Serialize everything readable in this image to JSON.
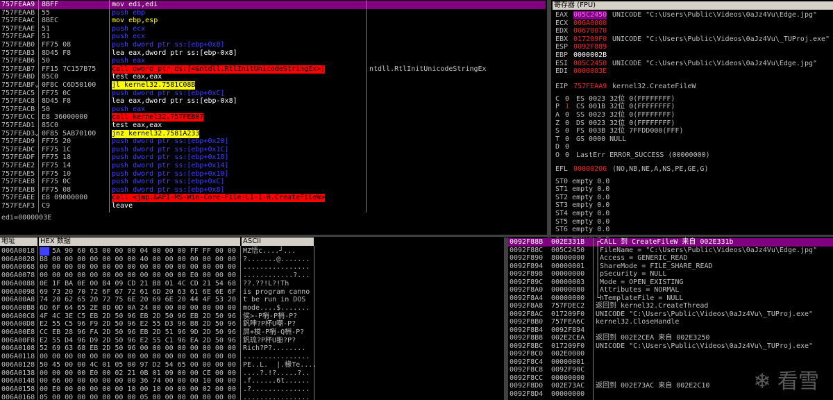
{
  "disasm": {
    "rows": [
      {
        "addr": "757FEAA9",
        "mark": "",
        "bytes": "8BFF",
        "instr": "mov edi,edi",
        "type": "mov",
        "comment": ""
      },
      {
        "addr": "757FEAAB",
        "mark": "",
        "bytes": "55",
        "instr": "push ebp",
        "type": "push",
        "comment": ""
      },
      {
        "addr": "757FEAAC",
        "mark": "",
        "bytes": "8BEC",
        "instr": "mov ebp,esp",
        "type": "mov",
        "comment": ""
      },
      {
        "addr": "757FEAAE",
        "mark": "",
        "bytes": "51",
        "instr": "push ecx",
        "type": "push",
        "comment": ""
      },
      {
        "addr": "757FEAAF",
        "mark": "",
        "bytes": "51",
        "instr": "push ecx",
        "type": "push",
        "comment": ""
      },
      {
        "addr": "757FEAB0",
        "mark": "",
        "bytes": "FF75 08",
        "instr": "push dword ptr ss:[ebp+0x8]",
        "type": "push",
        "comment": ""
      },
      {
        "addr": "757FEAB3",
        "mark": "",
        "bytes": "8D45 F8",
        "instr": "lea eax,dword ptr ss:[ebp-0x8]",
        "type": "lea",
        "comment": ""
      },
      {
        "addr": "757FEAB6",
        "mark": "",
        "bytes": "50",
        "instr": "push eax",
        "type": "push",
        "comment": ""
      },
      {
        "addr": "757FEAB7",
        "mark": "",
        "bytes": "FF15 7C157B75",
        "instr": "call dword ptr ds:[<&ntdll.RtlInitUnicodeStringEx>]",
        "type": "call",
        "comment": "ntdll.RtlInitUnicodeStringEx"
      },
      {
        "addr": "757FEABD",
        "mark": "",
        "bytes": "85C0",
        "instr": "test eax,eax",
        "type": "cmd",
        "comment": ""
      },
      {
        "addr": "757FEABF",
        "mark": "⌄",
        "bytes": "0F8C C6D50100",
        "instr": "jl kernel32.7581C08B",
        "type": "jmp",
        "comment": ""
      },
      {
        "addr": "757FEAC5",
        "mark": "",
        "bytes": "FF75 0C",
        "instr": "push dword ptr ss:[ebp+0xC]",
        "type": "push",
        "comment": ""
      },
      {
        "addr": "757FEAC8",
        "mark": "",
        "bytes": "8D45 F8",
        "instr": "lea eax,dword ptr ss:[ebp-0x8]",
        "type": "lea",
        "comment": ""
      },
      {
        "addr": "757FEACB",
        "mark": "",
        "bytes": "50",
        "instr": "push eax",
        "type": "push",
        "comment": ""
      },
      {
        "addr": "757FEACC",
        "mark": "",
        "bytes": "E8 36000000",
        "instr": "call kernel32.757FEB07",
        "type": "call",
        "comment": ""
      },
      {
        "addr": "757FEAD1",
        "mark": "",
        "bytes": "85C0",
        "instr": "test eax,eax",
        "type": "cmd",
        "comment": ""
      },
      {
        "addr": "757FEAD3",
        "mark": "⌄",
        "bytes": "0F85 5AB70100",
        "instr": "jnz kernel32.7581A233",
        "type": "jmp",
        "comment": ""
      },
      {
        "addr": "757FEAD9",
        "mark": "",
        "bytes": "FF75 20",
        "instr": "push dword ptr ss:[ebp+0x20]",
        "type": "push",
        "comment": ""
      },
      {
        "addr": "757FEADC",
        "mark": "",
        "bytes": "FF75 1C",
        "instr": "push dword ptr ss:[ebp+0x1C]",
        "type": "push",
        "comment": ""
      },
      {
        "addr": "757FEADF",
        "mark": "",
        "bytes": "FF75 18",
        "instr": "push dword ptr ss:[ebp+0x18]",
        "type": "push",
        "comment": ""
      },
      {
        "addr": "757FEAE2",
        "mark": "",
        "bytes": "FF75 14",
        "instr": "push dword ptr ss:[ebp+0x14]",
        "type": "push",
        "comment": ""
      },
      {
        "addr": "757FEAE5",
        "mark": "",
        "bytes": "FF75 10",
        "instr": "push dword ptr ss:[ebp+0x10]",
        "type": "push",
        "comment": ""
      },
      {
        "addr": "757FEAE8",
        "mark": "",
        "bytes": "FF75 0C",
        "instr": "push dword ptr ss:[ebp+0xC]",
        "type": "push",
        "comment": ""
      },
      {
        "addr": "757FEAEB",
        "mark": "",
        "bytes": "FF75 08",
        "instr": "push dword ptr ss:[ebp+0x8]",
        "type": "push",
        "comment": ""
      },
      {
        "addr": "757FEAEE",
        "mark": "",
        "bytes": "E8 09000000",
        "instr": "call <jmp.&API-MS-Win-Core-File-L1-1-0.CreateFileW>",
        "type": "call",
        "comment": ""
      },
      {
        "addr": "757FEAF3",
        "mark": "",
        "bytes": "C9",
        "instr": "leave",
        "type": "leave",
        "comment": ""
      }
    ]
  },
  "info_line": "edi=0000003E",
  "registers": {
    "title": "寄存器 (FPU)",
    "gp": [
      {
        "name": "EAX",
        "value": "005C2450",
        "hl": true,
        "note": "UNICODE \"C:\\Users\\Public\\Videos\\0aJz4Vu\\Edge.jpg\""
      },
      {
        "name": "ECX",
        "value": "006A0000",
        "hl": false,
        "note": ""
      },
      {
        "name": "EDX",
        "value": "00670070",
        "hl": false,
        "note": ""
      },
      {
        "name": "EBX",
        "value": "017209F0",
        "hl": false,
        "note": "UNICODE \"C:\\Users\\Public\\Videos\\0aJz4Vu\\_TUProj.exe\""
      },
      {
        "name": "ESP",
        "value": "0092F889",
        "hl": false,
        "note": ""
      },
      {
        "name": "EBP",
        "value": "0000002B",
        "hl": false,
        "white": true,
        "note": ""
      },
      {
        "name": "ESI",
        "value": "005C2450",
        "hl": false,
        "note": "UNICODE \"C:\\Users\\Public\\Videos\\0aJz4Vu\\Edge.jpg\""
      },
      {
        "name": "EDI",
        "value": "0000003E",
        "hl": false,
        "note": ""
      }
    ],
    "eip": {
      "name": "EIP",
      "value": "757FEAA9",
      "note": "kernel32.CreateFileW"
    },
    "flags": [
      {
        "f": "C",
        "v": "0",
        "seg": "ES 0023 32位 0(FFFFFFFF)"
      },
      {
        "f": "P",
        "v": "1",
        "seg": "CS 001B 32位 0(FFFFFFFF)"
      },
      {
        "f": "A",
        "v": "0",
        "seg": "SS 0023 32位 0(FFFFFFFF)"
      },
      {
        "f": "Z",
        "v": "0",
        "seg": "DS 0023 32位 0(FFFFFFFF)"
      },
      {
        "f": "S",
        "v": "0",
        "seg": "FS 003B 32位 7FFDD000(FFF)"
      },
      {
        "f": "T",
        "v": "0",
        "seg": "GS 0000 NULL"
      },
      {
        "f": "D",
        "v": "0",
        "seg": ""
      },
      {
        "f": "O",
        "v": "0",
        "seg": "LastErr ERROR_SUCCESS (00000000)"
      }
    ],
    "efl": {
      "name": "EFL",
      "value": "00000206",
      "note": "(NO,NB,NE,A,NS,PE,GE,G)"
    },
    "fpu": [
      "ST0 empty 0.0",
      "ST1 empty 0.0",
      "ST2 empty 0.0",
      "ST3 empty 0.0",
      "ST4 empty 0.0",
      "ST5 empty 0.0",
      "ST6 empty 0.0",
      "ST7 empty 0.0"
    ]
  },
  "dump": {
    "col_addr": "地址",
    "col_hex": "HEX 数据",
    "col_ascii": "ASCII",
    "rows": [
      {
        "addr": "006A0018",
        "hex": "4D 5A 90 60 63 00 00 00 04 00 00 00 FF FF 00 00",
        "ascii": "MZ悟c....┘..."
      },
      {
        "addr": "006A0028",
        "hex": "B8 00 00 00 00 00 00 00 40 00 00 00 00 00 00 00",
        "ascii": "?.......@......."
      },
      {
        "addr": "006A0068",
        "hex": "00 00 00 00 00 00 00 00 00 00 00 00 00 00 00 00",
        "ascii": "................"
      },
      {
        "addr": "006A0078",
        "hex": "00 00 00 00 00 00 00 00 00 00 00 00 E0 00 00 00",
        "ascii": "............?..."
      },
      {
        "addr": "006A0088",
        "hex": "0E 1F BA 0E 00 B4 09 CD 21 B8 01 4C CD 21 54 68",
        "ascii": "??.??!L?!Th"
      },
      {
        "addr": "006A0098",
        "hex": "69 73 20 70 72 6F 67 72 61 6D 20 63 61 6E 6E 6F",
        "ascii": "is program canno"
      },
      {
        "addr": "006A00A8",
        "hex": "74 20 62 65 20 72 75 6E 20 69 6E 20 44 4F 53 20",
        "ascii": "t be run in DOS "
      },
      {
        "addr": "006A00B8",
        "hex": "6D 6F 64 65 2E 0D 0D 0A 24 00 00 00 00 00 00 00",
        "ascii": "mode....$......."
      },
      {
        "addr": "006A00C8",
        "hex": "4F 4C 3E C5 EB 2D 50 96 EB 2D 50 96 EB 2D 50 96",
        "ascii": "侯>-P梢-P梢-P?"
      },
      {
        "addr": "006A00D8",
        "hex": "E2 55 C5 96 F9 2D 50 96 E2 55 D3 96 B8 2D 50 96",
        "ascii": "釩呻?P杯U嘲-P?"
      },
      {
        "addr": "006A00E8",
        "hex": "CC EB 28 96 FA 2D 50 96 EB 2D 51 96 9D 2D 50 96",
        "ascii": "屏+梭-P梢-Q栦-P?"
      },
      {
        "addr": "006A00F8",
        "hex": "E2 55 D4 96 D9 2D 50 96 E2 55 C1 96 EA 2D 50 96",
        "ascii": "釩琉?P杯U翂?P?"
      },
      {
        "addr": "006A0108",
        "hex": "52 69 63 68 EB 2D 50 96 00 00 00 00 00 00 00 00",
        "ascii": "Rich?P?........"
      },
      {
        "addr": "006A0118",
        "hex": "00 00 00 00 00 00 00 00 00 00 00 00 00 00 00 00",
        "ascii": "................"
      },
      {
        "addr": "006A0128",
        "hex": "50 45 00 00 4C 01 05 00 97 D2 54 65 00 00 00 00",
        "ascii": "PE..L.  |.椽Te...."
      },
      {
        "addr": "006A0138",
        "hex": "00 00 00 00 E0 00 02 21 0B 01 09 00 00 CE 00 00",
        "ascii": "....?.!?.....?.."
      },
      {
        "addr": "006A0148",
        "hex": "00 66 00 00 00 00 00 00 36 74 00 00 00 10 00 00",
        "ascii": ".f......6t......"
      },
      {
        "addr": "006A0158",
        "hex": "00 E0 00 00 00 00 00 10 00 10 00 00 00 02 00 00",
        "ascii": ".?.............."
      },
      {
        "addr": "006A0168",
        "hex": "05 00 00 00 00 00 00 00 05 00 00 00 00 00 00 00",
        "ascii": "................"
      }
    ]
  },
  "stack": {
    "rows": [
      {
        "addr": "0092F88B",
        "val": "002E331B",
        "note": "┌CALL 到 CreateFileW 来自 002E331b",
        "sel": true
      },
      {
        "addr": "0092F88C",
        "val": "005C2450",
        "note": "│FileName = \"C:\\Users\\Public\\Videos\\0aJz4Vu\\Edge.jpg\""
      },
      {
        "addr": "0092F890",
        "val": "80000000",
        "note": "│Access = GENERIC_READ"
      },
      {
        "addr": "0092F894",
        "val": "00000001",
        "note": "│ShareMode = FILE_SHARE_READ"
      },
      {
        "addr": "0092F898",
        "val": "00000000",
        "note": "│pSecurity = NULL"
      },
      {
        "addr": "0092F89C",
        "val": "00000003",
        "note": "│Mode = OPEN_EXISTING"
      },
      {
        "addr": "0092F8A0",
        "val": "00000080",
        "note": "│Attributes = NORMAL"
      },
      {
        "addr": "0092F8A4",
        "val": "00000000",
        "note": "└hTemplateFile = NULL"
      },
      {
        "addr": "0092F8A8",
        "val": "757FDEC2",
        "note": "返回到 kernel32.CreateThread"
      },
      {
        "addr": "0092F8AC",
        "val": "017209F0",
        "note": "UNICODE \"C:\\Users\\Public\\Videos\\0aJz4Vu\\_TUProj.exe\""
      },
      {
        "addr": "0092F8B0",
        "val": "757FEA6C",
        "note": "kernel32.CloseHandle"
      },
      {
        "addr": "0092F8B4",
        "val": "0092F894",
        "note": ""
      },
      {
        "addr": "0092F8B8",
        "val": "002E2CEA",
        "note": "返回到 002E2CEA 来自 002E3250"
      },
      {
        "addr": "0092F8BC",
        "val": "017209F0",
        "note": "UNICODE \"C:\\Users\\Public\\Videos\\0aJz4Vu\\_TUProj.exe\""
      },
      {
        "addr": "0092F8C0",
        "val": "002E0000",
        "note": ""
      },
      {
        "addr": "0092F8C4",
        "val": "00000001",
        "note": ""
      },
      {
        "addr": "0092F8C8",
        "val": "0092F90C",
        "note": ""
      },
      {
        "addr": "0092F8CC",
        "val": "00000000",
        "note": ""
      },
      {
        "addr": "0092F8D0",
        "val": "002E73AC",
        "note": "返回到 002E73AC 来自 002E2C10"
      },
      {
        "addr": "0092F8D4",
        "val": "00000000",
        "note": ""
      }
    ]
  },
  "watermark": "看雪"
}
